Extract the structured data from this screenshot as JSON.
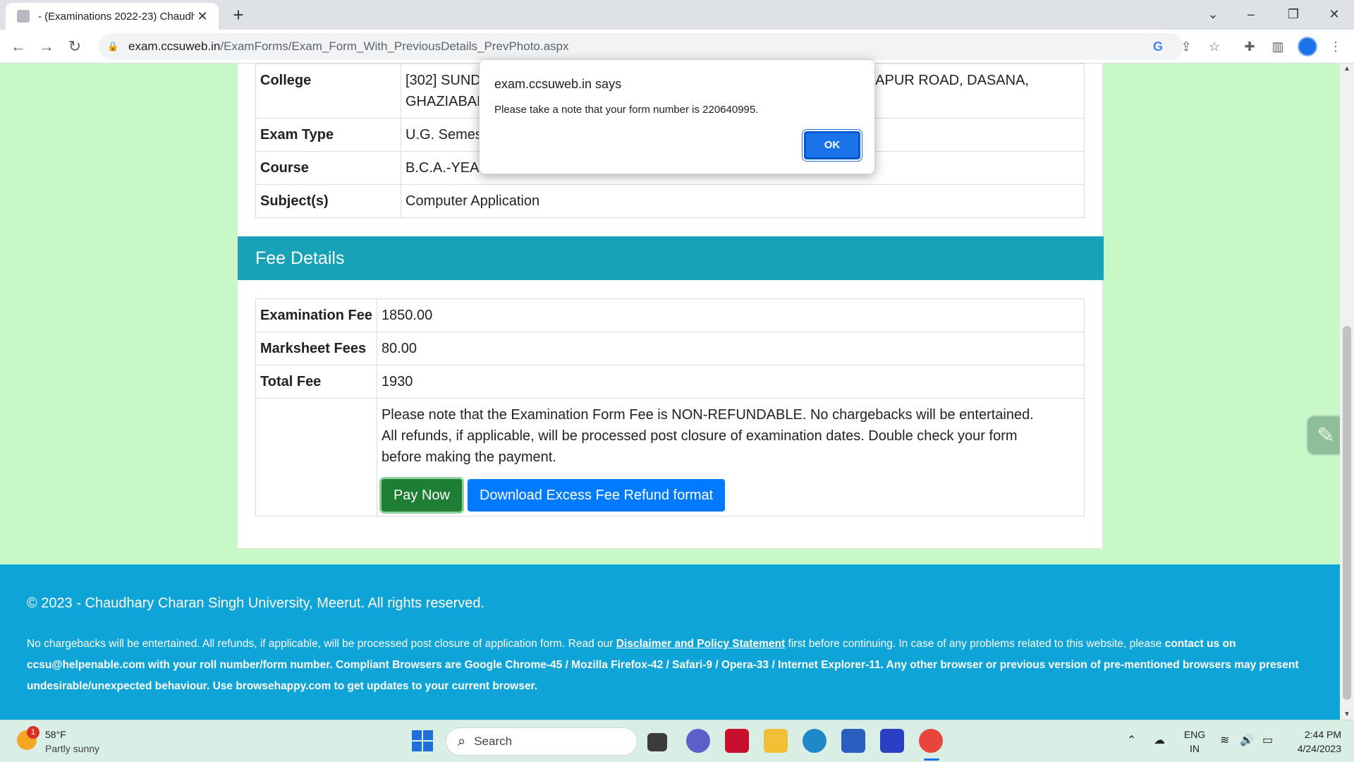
{
  "browser": {
    "tab_title": " - (Examinations 2022-23) Chaudh",
    "url_host": "exam.ccsuweb.in",
    "url_path": "/ExamForms/Exam_Form_With_PreviousDetails_PrevPhoto.aspx"
  },
  "info_table": [
    {
      "label": "College",
      "value_left": "[302] SUND",
      "value_right": "-HAPUR ROAD, DASANA,",
      "value_line2": "GHAZIABAD"
    },
    {
      "label": "Exam Type",
      "value": "U.G. Semest"
    },
    {
      "label": "Course",
      "value": "B.C.A.-YEAR"
    },
    {
      "label": "Subject(s)",
      "value": "Computer Application"
    }
  ],
  "fee_section": {
    "title": "Fee Details",
    "rows": [
      {
        "label": "Examination Fee",
        "value": "1850.00"
      },
      {
        "label": "Marksheet Fees",
        "value": "80.00"
      },
      {
        "label": "Total Fee",
        "value": "1930"
      }
    ],
    "notice": "Please note that the Examination Form Fee is NON-REFUNDABLE. No chargebacks will be entertained. All refunds, if applicable, will be processed post closure of examination dates. Double check your form before making the payment.",
    "pay_button": "Pay Now",
    "download_button": "Download Excess Fee Refund format"
  },
  "footer": {
    "copyright": "© 2023 - Chaudhary Charan Singh University, Meerut. All rights reserved.",
    "note_part1": "No chargebacks will be entertained. All refunds, if applicable, will be processed post closure of application form. Read our ",
    "note_link": "Disclaimer and Policy Statement",
    "note_part2": " first before continuing. In case of any problems related to this website, please ",
    "note_bold": "contact us on ccsu@helpenable.com with your roll number/form number. Compliant Browsers are Google Chrome-45 / Mozilla Firefox-42 / Safari-9 / Opera-33 / Internet Explorer-11. Any other browser or previous version of pre-mentioned browsers may present undesirable/unexpected behaviour. Use browsehappy.com to get updates to your current browser."
  },
  "dialog": {
    "title": "exam.ccsuweb.in says",
    "message": "Please take a note that your form number is 220640995.",
    "ok_label": "OK"
  },
  "taskbar": {
    "weather_badge": "1",
    "temperature": "58°F",
    "condition": "Partly sunny",
    "search_label": "Search",
    "lang_line1": "ENG",
    "lang_line2": "IN",
    "time": "2:44 PM",
    "date": "4/24/2023"
  },
  "colors": {
    "page_bg": "#c8f7c8",
    "fee_header": "#17a2b8",
    "footer": "#0ea4d8",
    "pay_button": "#1e7e34",
    "download_button": "#007bff",
    "dialog_ok": "#1a73e8"
  }
}
